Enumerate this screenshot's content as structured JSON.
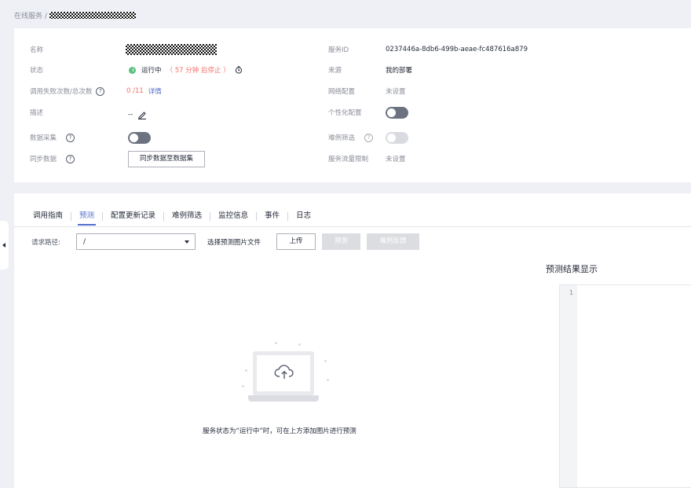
{
  "breadcrumb": {
    "root": "在线服务 /"
  },
  "info": {
    "name_label": "名称",
    "status_label": "状态",
    "status_value": "运行中",
    "status_countdown": "（ 57 分钟 后停止 ）",
    "calls_label": "调用失败次数/总次数",
    "calls_value": "0 /11",
    "calls_detail": "详情",
    "desc_label": "描述",
    "desc_value": "--",
    "collect_label": "数据采集",
    "sync_label": "同步数据",
    "sync_button": "同步数据至数据集",
    "service_id_label": "服务ID",
    "service_id_value": "0237446a-8db6-499b-aeae-fc487616a879",
    "source_label": "来源",
    "source_value": "我的部署",
    "network_label": "网络配置",
    "network_value": "未设置",
    "custom_label": "个性化配置",
    "hard_label": "难例筛选",
    "traffic_label": "服务流量限制",
    "traffic_value": "未设置"
  },
  "tabs": [
    {
      "label": "调用指南"
    },
    {
      "label": "预测"
    },
    {
      "label": "配置更新记录"
    },
    {
      "label": "难例筛选"
    },
    {
      "label": "监控信息"
    },
    {
      "label": "事件"
    },
    {
      "label": "日志"
    }
  ],
  "predict": {
    "path_label": "请求路径:",
    "path_value": "/",
    "choose_label": "选择预测图片文件",
    "upload_button": "上传",
    "predict_button": "预测",
    "feedback_button": "难例反馈",
    "empty_text": "服务状态为“运行中”时，可在上方添加图片进行预测",
    "result_title": "预测结果显示",
    "line_number": "1"
  }
}
